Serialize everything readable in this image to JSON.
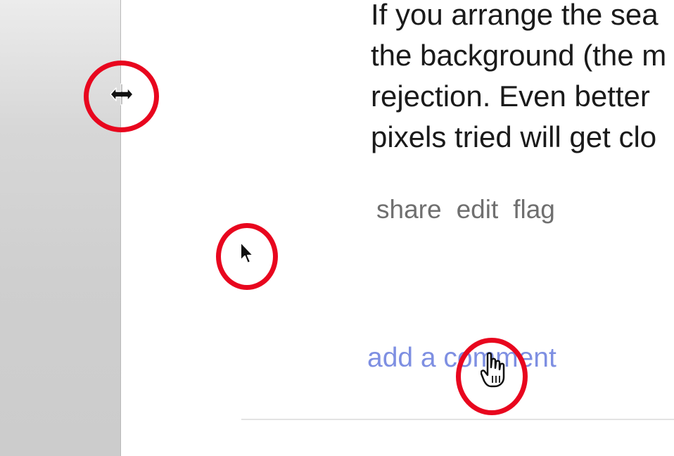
{
  "answer": {
    "lines": [
      "If you arrange the sea",
      "the background (the m",
      "rejection. Even better",
      "pixels tried will get clo"
    ]
  },
  "post_menu": {
    "share": "share",
    "edit": "edit",
    "flag": "flag"
  },
  "comment": {
    "add_label": "add a comment"
  },
  "colors": {
    "marker_ring": "#e8061e",
    "link": "#7e8fe2",
    "menu_text": "#6f6f6f"
  },
  "cursors": [
    "resize-horizontal-cursor-icon",
    "arrow-pointer-cursor-icon",
    "hand-pointer-cursor-icon"
  ]
}
